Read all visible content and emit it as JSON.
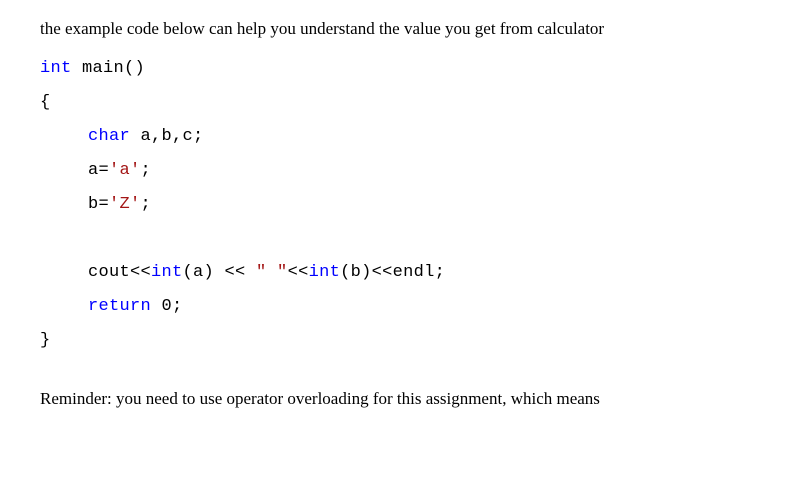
{
  "intro": "the example code below can help you understand the value you get from calculator",
  "code": {
    "l1_kw": "int",
    "l1_rest": " main()",
    "l2": "{",
    "l3_kw": "char",
    "l3_rest": " a,b,c;",
    "l4_a": "a=",
    "l4_s": "'a'",
    "l4_b": ";",
    "l5_a": "b=",
    "l5_s": "'Z'",
    "l5_b": ";",
    "l6_a": "cout<<",
    "l6_kw1": "int",
    "l6_b": "(a) << ",
    "l6_s": "\" \"",
    "l6_c": "<<",
    "l6_kw2": "int",
    "l6_d": "(b)<<endl;",
    "l7_kw": "return",
    "l7_rest": " 0;",
    "l8": "}"
  },
  "reminder": "Reminder: you need to use operator overloading for this assignment, which means"
}
